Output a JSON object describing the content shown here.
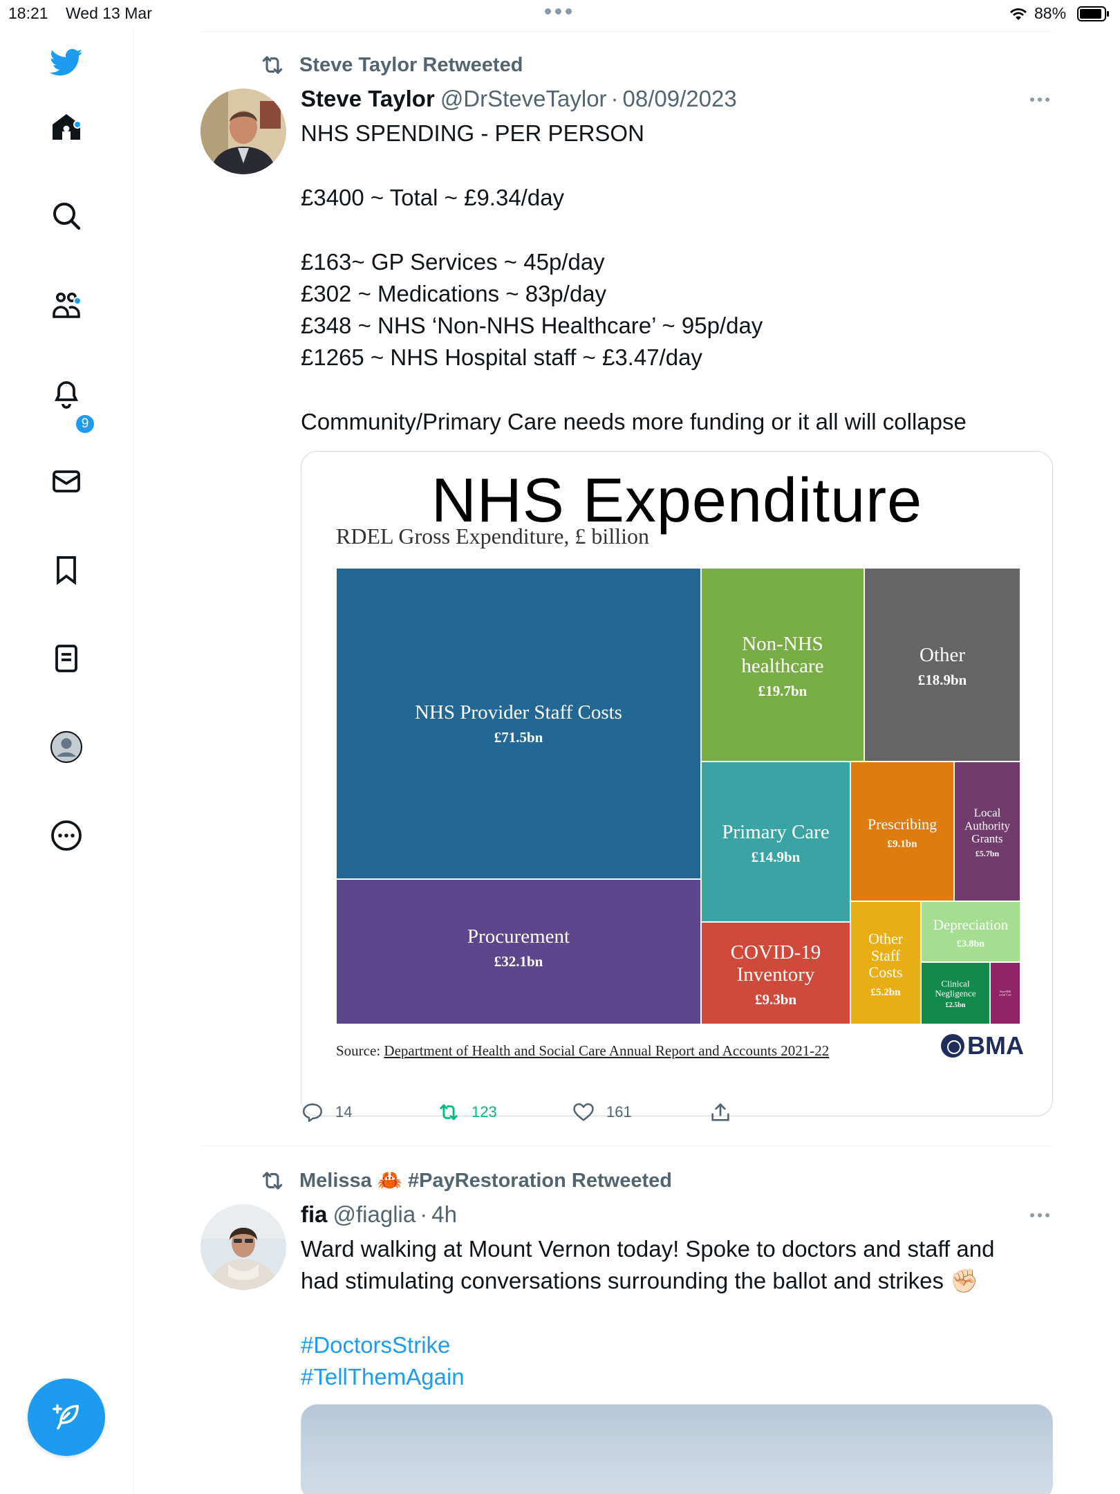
{
  "status_bar": {
    "time": "18:21",
    "date": "Wed 13 Mar",
    "battery": "88%"
  },
  "nav": {
    "items": [
      "Twitter",
      "Home",
      "Explore",
      "Communities",
      "Notifications",
      "Messages",
      "Bookmarks",
      "Lists",
      "Profile",
      "More"
    ],
    "notification_count": "9",
    "compose_label": "Tweet"
  },
  "tweet1": {
    "retweeted_by": "Steve Taylor Retweeted",
    "author_name": "Steve Taylor",
    "author_handle": "@DrSteveTaylor",
    "separator": "·",
    "date": "08/09/2023",
    "text_lines": [
      "NHS SPENDING - PER PERSON",
      "£3400 ~ Total ~ £9.34/day",
      "£163~ GP Services ~ 45p/day",
      "£302 ~ Medications ~ 83p/day",
      "£348 ~ NHS ‘Non-NHS Healthcare’ ~ 95p/day",
      "£1265 ~ NHS Hospital staff ~ £3.47/day",
      "Community/Primary Care needs more funding or it all will collapse"
    ],
    "replies": "14",
    "retweets": "123",
    "likes": "161"
  },
  "chart": {
    "source_prefix": "Source:",
    "source_link": "Department of Health and Social Care Annual Report and Accounts 2021-22",
    "logo": "BMA"
  },
  "chart_data": {
    "type": "treemap",
    "title": "NHS Expenditure",
    "subtitle": "RDEL Gross Expenditure, £ billion",
    "unit": "£ billion",
    "items": [
      {
        "label": "NHS Provider Staff Costs",
        "value_label": "£71.5bn",
        "value": 71.5,
        "color": "#236895"
      },
      {
        "label": "Procurement",
        "value_label": "£32.1bn",
        "value": 32.1,
        "color": "#5d468c"
      },
      {
        "label": "Non-NHS healthcare",
        "value_label": "£19.7bn",
        "value": 19.7,
        "color": "#78ad45"
      },
      {
        "label": "Other",
        "value_label": "£18.9bn",
        "value": 18.9,
        "color": "#656565"
      },
      {
        "label": "Primary Care",
        "value_label": "£14.9bn",
        "value": 14.9,
        "color": "#3aa3a4"
      },
      {
        "label": "COVID-19 Inventory",
        "value_label": "£9.3bn",
        "value": 9.3,
        "color": "#cf4a3b"
      },
      {
        "label": "Prescribing",
        "value_label": "£9.1bn",
        "value": 9.1,
        "color": "#de7c0f"
      },
      {
        "label": "Local Authority Grants",
        "value_label": "£5.7bn",
        "value": 5.7,
        "color": "#703c6b"
      },
      {
        "label": "Other Staff Costs",
        "value_label": "£5.2bn",
        "value": 5.2,
        "color": "#e9ae13"
      },
      {
        "label": "Depreciation",
        "value_label": "£3.8bn",
        "value": 3.8,
        "color": "#a5dd91"
      },
      {
        "label": "Clinical Negligence",
        "value_label": "£2.5bn",
        "value": 2.5,
        "color": "#138a4c"
      },
      {
        "label": "Non-NHS social Care",
        "value_label": "",
        "value": 0.8,
        "color": "#8f2366"
      }
    ]
  },
  "tweet2": {
    "retweeted_by": "Melissa 🦀 #PayRestoration Retweeted",
    "author_name": "fia",
    "author_handle": "@fiaglia",
    "separator": "·",
    "time": "4h",
    "text_lines": [
      "Ward walking at Mount Vernon today! Spoke to doctors and staff and",
      "had stimulating conversations surrounding the ballot and strikes ✊🏻"
    ],
    "hashtags": [
      "#DoctorsStrike",
      "#TellThemAgain"
    ]
  }
}
